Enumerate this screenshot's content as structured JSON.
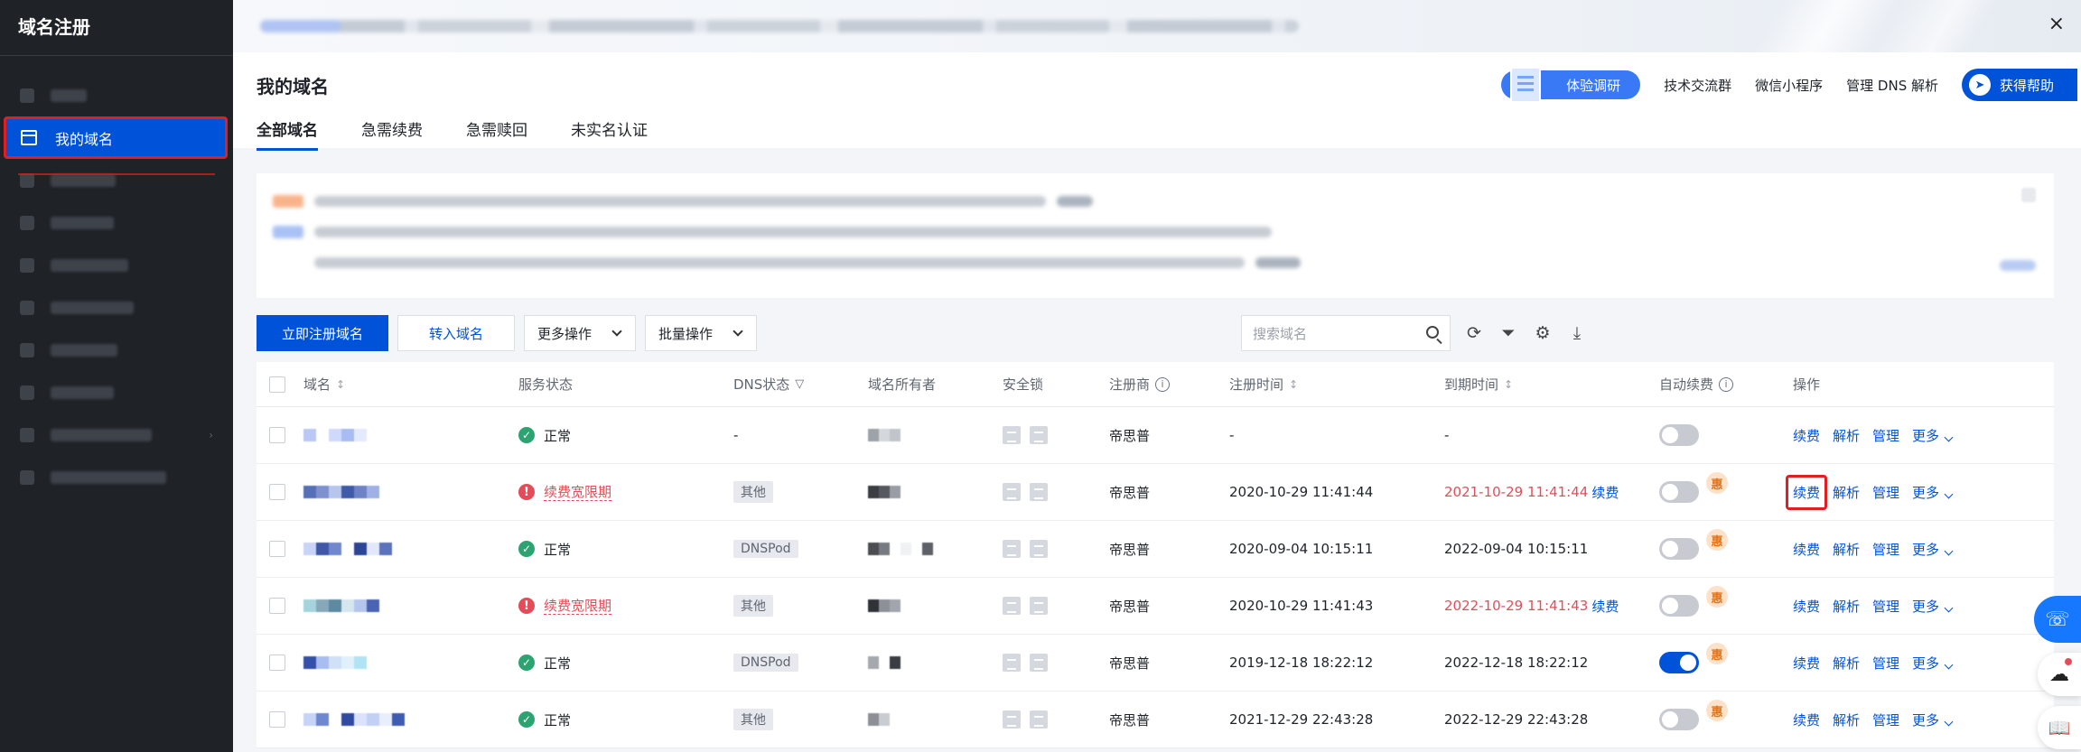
{
  "sidebar": {
    "title": "域名注册",
    "active_item": "我的域名"
  },
  "window": {
    "close": "×"
  },
  "header": {
    "title": "我的域名",
    "tabs": [
      "全部域名",
      "急需续费",
      "急需赎回",
      "未实名认证"
    ],
    "survey": "体验调研",
    "links": [
      "技术交流群",
      "微信小程序",
      "管理 DNS 解析"
    ],
    "help": "获得帮助"
  },
  "toolbar": {
    "register": "立即注册域名",
    "transfer": "转入域名",
    "more_ops": "更多操作",
    "batch_ops": "批量操作",
    "search_placeholder": "搜索域名"
  },
  "table": {
    "columns": [
      "域名",
      "服务状态",
      "DNS状态",
      "域名所有者",
      "安全锁",
      "注册商",
      "注册时间",
      "到期时间",
      "自动续费",
      "操作"
    ],
    "rows": [
      {
        "status": "正常",
        "status_type": "ok",
        "dns": "-",
        "registrar": "帝思普",
        "reg_time": "-",
        "exp_time": "-",
        "exp_red": false,
        "exp_renew": "",
        "auto": false,
        "hui": ""
      },
      {
        "status": "续费宽限期",
        "status_type": "err",
        "dns": "其他",
        "registrar": "帝思普",
        "reg_time": "2020-10-29 11:41:44",
        "exp_time": "2021-10-29 11:41:44",
        "exp_red": true,
        "exp_renew": "续费",
        "auto": false,
        "hui": "惠"
      },
      {
        "status": "正常",
        "status_type": "ok",
        "dns": "DNSPod",
        "registrar": "帝思普",
        "reg_time": "2020-09-04 10:15:11",
        "exp_time": "2022-09-04 10:15:11",
        "exp_red": false,
        "exp_renew": "",
        "auto": false,
        "hui": "惠"
      },
      {
        "status": "续费宽限期",
        "status_type": "err",
        "dns": "其他",
        "registrar": "帝思普",
        "reg_time": "2020-10-29 11:41:43",
        "exp_time": "2022-10-29 11:41:43",
        "exp_red": true,
        "exp_renew": "续费",
        "auto": false,
        "hui": "惠"
      },
      {
        "status": "正常",
        "status_type": "ok",
        "dns": "DNSPod",
        "registrar": "帝思普",
        "reg_time": "2019-12-18 18:22:12",
        "exp_time": "2022-12-18 18:22:12",
        "exp_red": false,
        "exp_renew": "",
        "auto": true,
        "hui": "惠"
      },
      {
        "status": "正常",
        "status_type": "ok",
        "dns": "其他",
        "registrar": "帝思普",
        "reg_time": "2021-12-29 22:43:28",
        "exp_time": "2022-12-29 22:43:28",
        "exp_red": false,
        "exp_renew": "",
        "auto": false,
        "hui": "惠"
      }
    ],
    "ops": [
      "续费",
      "解析",
      "管理",
      "更多"
    ]
  },
  "colors": {
    "primary": "#0052d9",
    "danger": "#e34d59",
    "success": "#2ba471",
    "highlight": "#e02020"
  }
}
